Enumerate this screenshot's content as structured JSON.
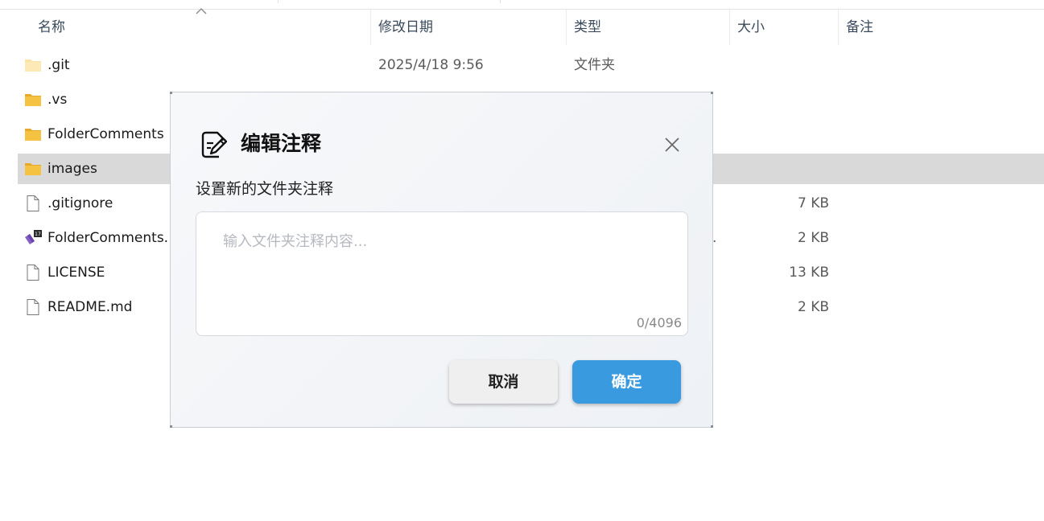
{
  "columns": {
    "name": "名称",
    "modified": "修改日期",
    "type": "类型",
    "size": "大小",
    "comment": "备注"
  },
  "files": [
    {
      "name": ".git",
      "modified": "2025/4/18 9:56",
      "type": "文件夹",
      "size": "",
      "kind": "folder-light"
    },
    {
      "name": ".vs",
      "modified": "",
      "type": "",
      "size": "",
      "kind": "folder"
    },
    {
      "name": "FolderComments",
      "modified": "",
      "type": "",
      "size": "",
      "kind": "folder"
    },
    {
      "name": "images",
      "modified": "",
      "type": "",
      "size": "",
      "kind": "folder",
      "selected": true
    },
    {
      "name": ".gitignore",
      "modified": "",
      "type": "",
      "size": "7 KB",
      "kind": "file"
    },
    {
      "name": "FolderComments.",
      "modified": "",
      "type": "",
      "size": "2 KB",
      "kind": "vs-solution",
      "trunc": "."
    },
    {
      "name": "LICENSE",
      "modified": "",
      "type": "",
      "size": "13 KB",
      "kind": "file"
    },
    {
      "name": "README.md",
      "modified": "",
      "type": "",
      "size": "2 KB",
      "kind": "file"
    }
  ],
  "dialog": {
    "title": "编辑注释",
    "label": "设置新的文件夹注释",
    "placeholder": "输入文件夹注释内容...",
    "counter": "0/4096",
    "cancel_label": "取消",
    "ok_label": "确定",
    "icon": "edit-note-icon",
    "close_icon": "close-icon"
  },
  "colors": {
    "accent": "#3a9ae0",
    "selected_row": "#d9d9d9",
    "folder": "#f5c242"
  }
}
